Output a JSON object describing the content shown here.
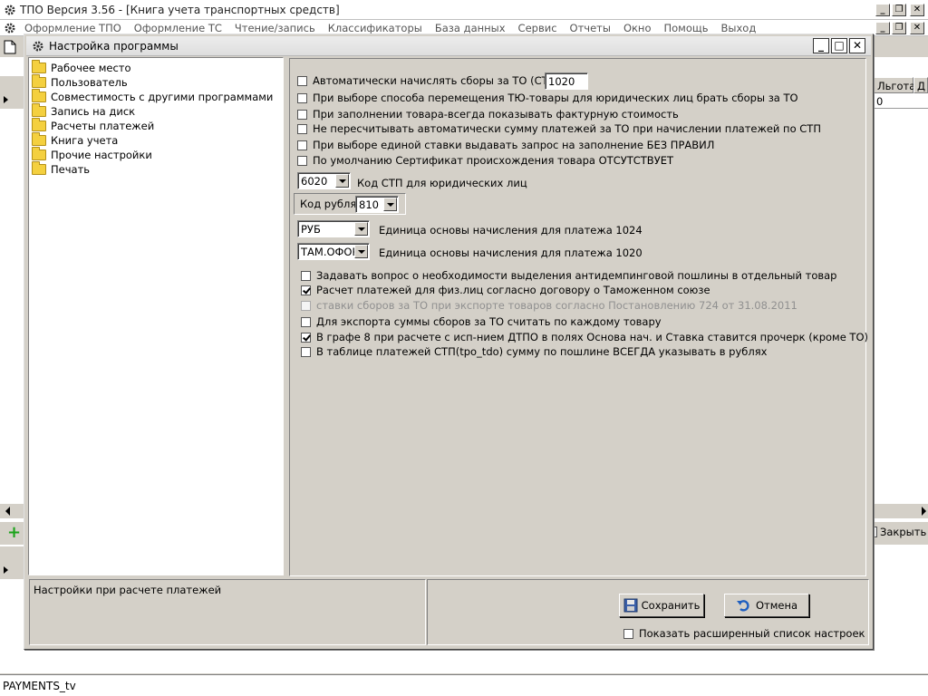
{
  "main_window": {
    "title": "ТПО Версия 3.56 - [Книга учета транспортных средств]",
    "menu": [
      "Оформление ТПО",
      "Оформление ТС",
      "Чтение/запись",
      "Классификаторы",
      "База данных",
      "Сервис",
      "Отчеты",
      "Окно",
      "Помощь",
      "Выход"
    ],
    "grid_columns": [
      "Льгота",
      "Д"
    ],
    "grid_cell": "0",
    "close_button_label": "Закрыть",
    "status_text": "PAYMENTS_tv"
  },
  "dialog": {
    "title": "Настройка программы",
    "tree_items": [
      "Рабочее место",
      "Пользователь",
      "Совместимость с другими программами",
      "Запись на диск",
      "Расчеты платежей",
      "Книга учета",
      "Прочие настройки",
      "Печать"
    ],
    "options_top": [
      {
        "label": "Автоматически начислять сборы за ТО (СТП)",
        "checked": false
      },
      {
        "label": "При выборе способа перемещения ТЮ-товары для юридических лиц брать сборы за ТО",
        "checked": false
      },
      {
        "label": "При заполнении товара-всегда показывать фактурную стоимость",
        "checked": false
      },
      {
        "label": "Не пересчитывать автоматически сумму платежей за ТО при начислении платежей по СТП",
        "checked": false
      },
      {
        "label": "При выборе единой ставки выдавать запрос на заполнение БЕЗ ПРАВИЛ",
        "checked": false
      },
      {
        "label": "По умолчанию Сертификат происхождения товара  ОТСУТСТВУЕТ",
        "checked": false
      }
    ],
    "auto_fee_value": "1020",
    "stp_code": {
      "value": "6020",
      "label": "Код СТП для юридических лиц"
    },
    "ruble_code": {
      "label": "Код рубля",
      "value": "810"
    },
    "unit_1024": {
      "value": "РУБ",
      "label": "Единица основы начисления для платежа 1024"
    },
    "unit_1020": {
      "value": "ТАМ.ОФОР",
      "label": "Единица основы начисления для платежа 1020"
    },
    "options_bottom": [
      {
        "label": "Задавать вопрос о необходимости выделения антидемпинговой пошлины в отдельный товар",
        "checked": false,
        "disabled": false
      },
      {
        "label": "Расчет платежей для физ.лиц согласно договору о Таможенном союзе",
        "checked": true,
        "disabled": false
      },
      {
        "label": "ставки сборов за ТО при экспорте товаров согласно Постановлению 724 от 31.08.2011",
        "checked": false,
        "disabled": true
      },
      {
        "label": "Для экспорта суммы сборов за ТО считать по каждому товару",
        "checked": false,
        "disabled": false
      },
      {
        "label": "В графе 8 при расчете с исп-нием ДТПО в полях Основа нач. и Ставка ставится прочерк (кроме ТО)",
        "checked": true,
        "disabled": false
      },
      {
        "label": "В таблице платежей СТП(tpo_tdo) сумму по пошлине ВСЕГДА указывать в рублях",
        "checked": false,
        "disabled": false
      }
    ],
    "description": "Настройки при расчете платежей",
    "save_label": "Сохранить",
    "cancel_label": "Отмена",
    "extended_label": "Показать расширенный список настроек"
  }
}
